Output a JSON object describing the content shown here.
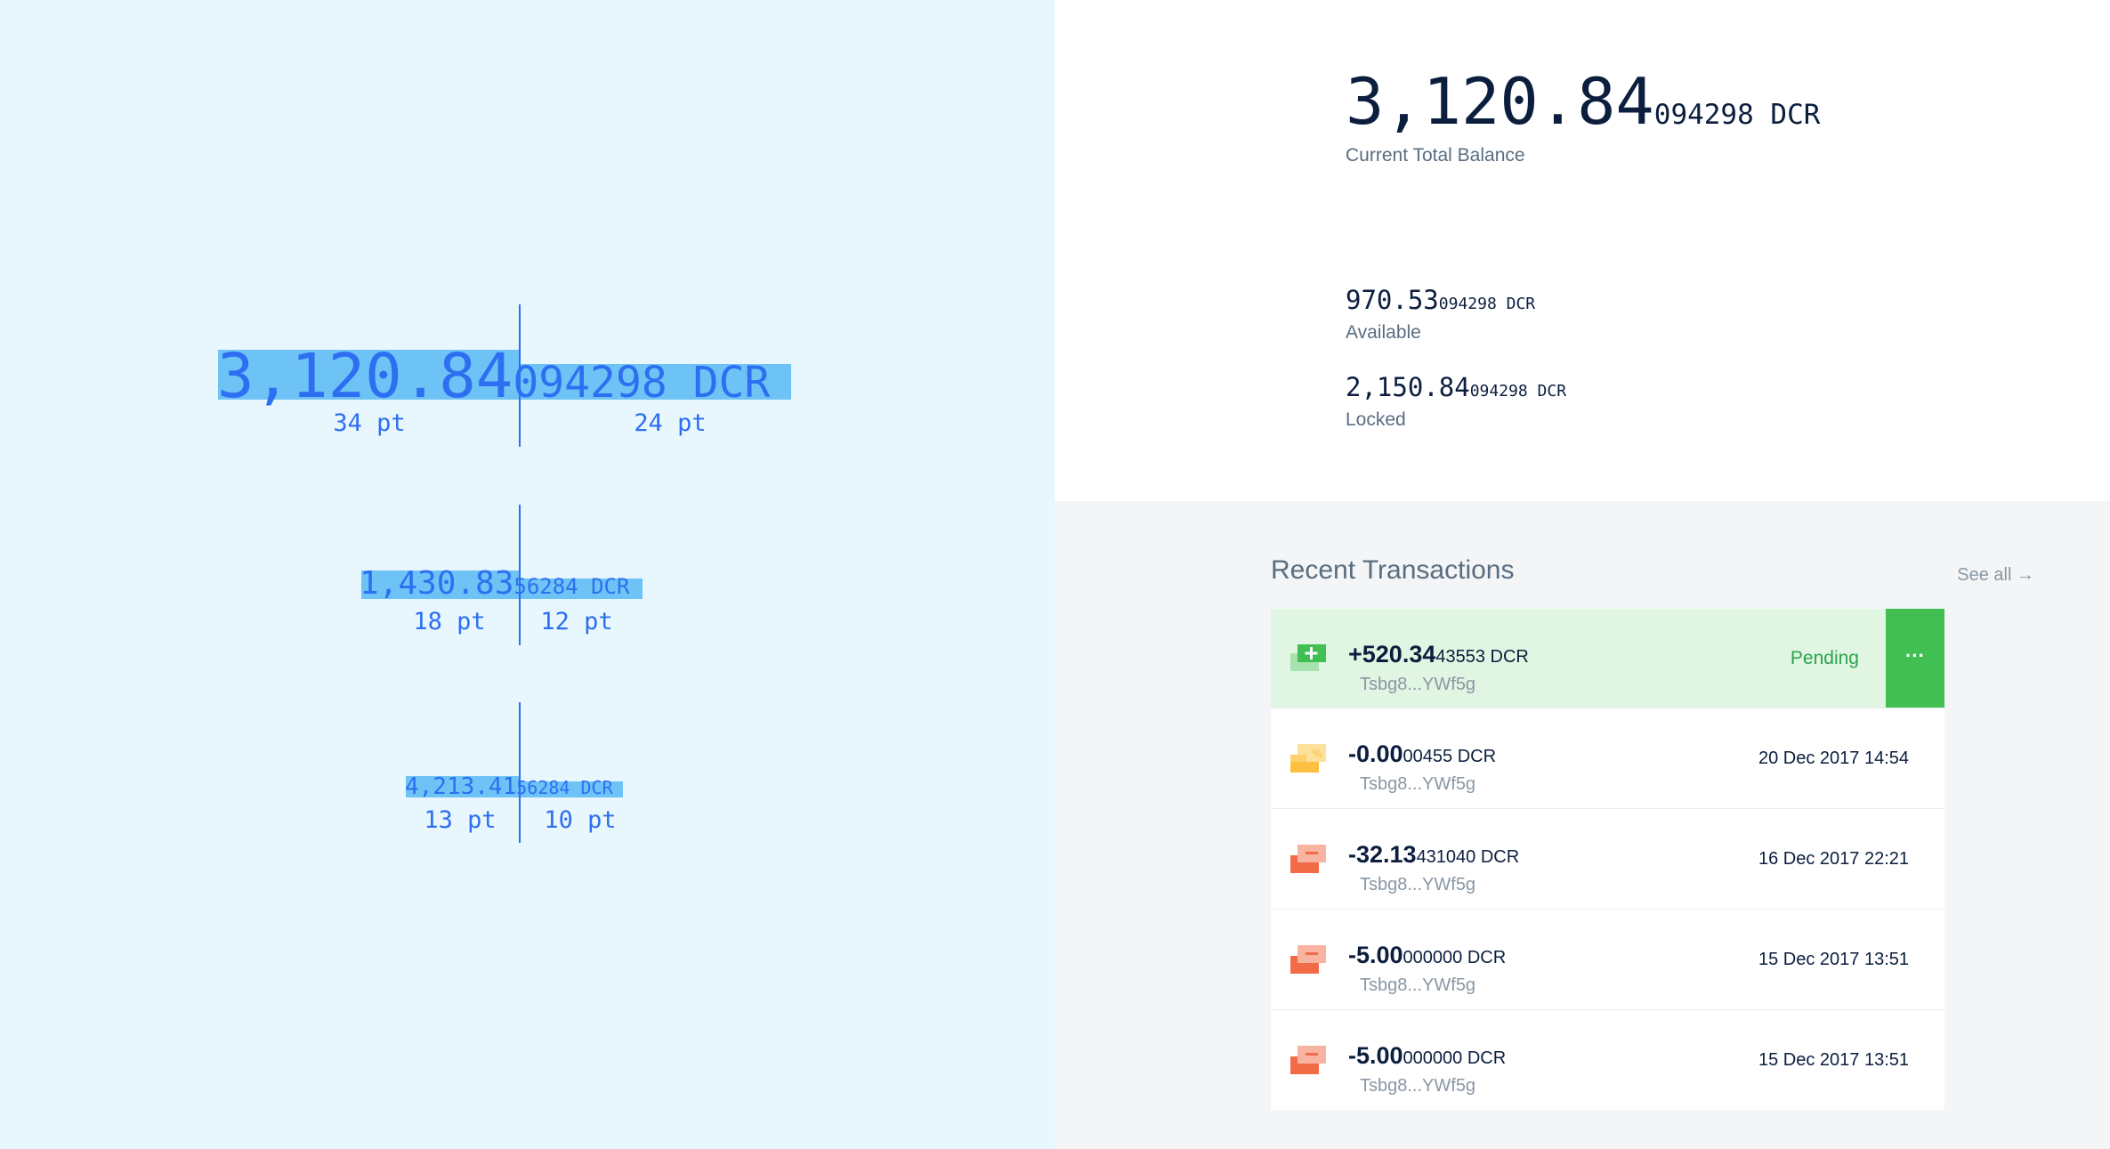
{
  "spec": {
    "large": {
      "integer": "3,120.84",
      "decimals": "094298 DCR",
      "int_size": "34 pt",
      "dec_size": "24 pt"
    },
    "medium": {
      "integer": "1,430.83",
      "decimals": "56284 DCR",
      "int_size": "18 pt",
      "dec_size": "12 pt"
    },
    "small": {
      "integer": "4,213.41",
      "decimals": "56284 DCR",
      "int_size": "13 pt",
      "dec_size": "10 pt"
    },
    "colors": {
      "background": "#e8f6fe",
      "accent": "#2d6ff0",
      "highlight": "#6ec3f6"
    }
  },
  "balance": {
    "total_integer": "3,120.84",
    "total_decimals": "094298 DCR",
    "total_label": "Current Total Balance",
    "available_integer": "970.53",
    "available_decimals": "094298 DCR",
    "available_label": "Available",
    "locked_integer": "2,150.84",
    "locked_decimals": "094298 DCR",
    "locked_label": "Locked"
  },
  "transactions": {
    "title": "Recent Transactions",
    "see_all": "See all →",
    "items": [
      {
        "type": "receive",
        "amount_big": "+520.34",
        "amount_small": "43553 DCR",
        "address": "Tsbg8...YWf5g",
        "status": "Pending",
        "more": "···",
        "icon": "receive-icon"
      },
      {
        "type": "ticket",
        "amount_big": "-0.00",
        "amount_small": "00455 DCR",
        "address": "Tsbg8...YWf5g",
        "date": "20 Dec 2017 14:54",
        "icon": "ticket-fee-icon"
      },
      {
        "type": "send",
        "amount_big": "-32.13",
        "amount_small": "431040 DCR",
        "address": "Tsbg8...YWf5g",
        "date": "16 Dec 2017 22:21",
        "icon": "send-icon"
      },
      {
        "type": "send",
        "amount_big": "-5.00",
        "amount_small": "000000 DCR",
        "address": "Tsbg8...YWf5g",
        "date": "15 Dec 2017 13:51",
        "icon": "send-icon"
      },
      {
        "type": "send",
        "amount_big": "-5.00",
        "amount_small": "000000 DCR",
        "address": "Tsbg8...YWf5g",
        "date": "15 Dec 2017 13:51",
        "icon": "send-icon"
      }
    ],
    "colors": {
      "pending_bg": "#e0f5e2",
      "pending_text": "#2ba44e",
      "more_button": "#41bf53",
      "send": "#f26b47",
      "ticket": "#fcbf3f"
    }
  }
}
